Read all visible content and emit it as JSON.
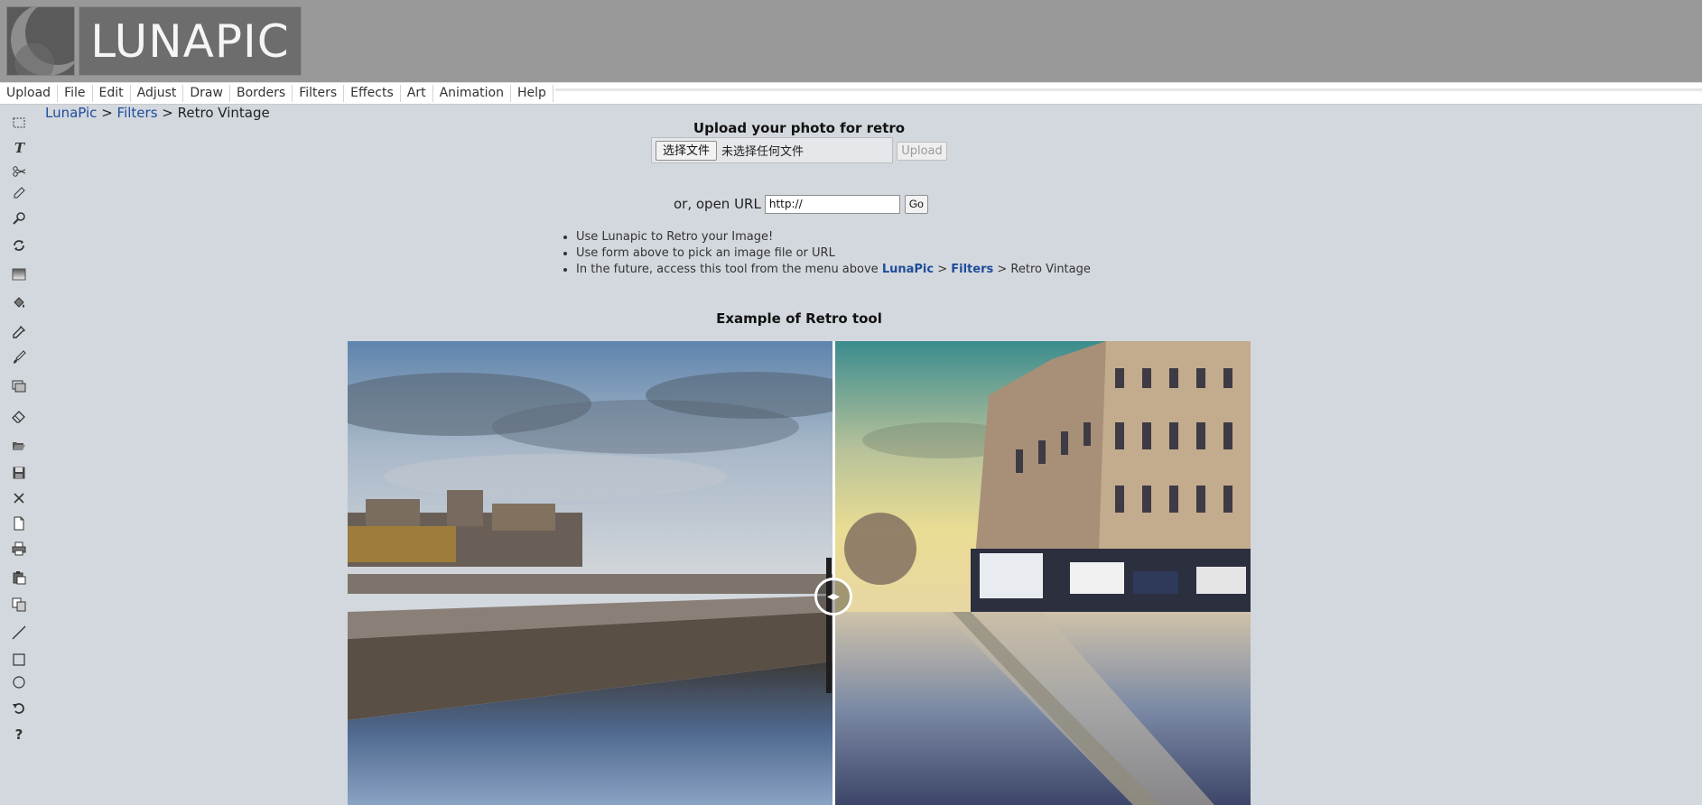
{
  "app": {
    "logo_text": "LUNAPIC"
  },
  "menu": {
    "items": [
      "Upload",
      "File",
      "Edit",
      "Adjust",
      "Draw",
      "Borders",
      "Filters",
      "Effects",
      "Art",
      "Animation",
      "Help"
    ]
  },
  "toolbar": {
    "tools": [
      "marquee-select-icon",
      "text-icon",
      "scissors-icon",
      "pencil-icon",
      "zoom-icon",
      "rotate-icon",
      "gradient-icon",
      "paint-bucket-icon",
      "color-picker-icon",
      "brush-icon",
      "image-stack-icon",
      "eraser-icon",
      "open-folder-icon",
      "save-icon",
      "close-icon",
      "new-document-icon",
      "print-icon",
      "paste-icon",
      "copy-icon",
      "line-icon",
      "rectangle-icon",
      "circle-icon",
      "undo-icon",
      "help-icon"
    ]
  },
  "breadcrumb": {
    "home": "LunaPic",
    "sep1": " > ",
    "section": "Filters",
    "sep2": " > ",
    "current": "Retro Vintage"
  },
  "upload": {
    "title": "Upload your photo for retro",
    "choose_file_label": "选择文件",
    "file_status": "未选择任何文件",
    "upload_button": "Upload",
    "url_label": "or, open URL",
    "url_value": "http://",
    "go_button": "Go"
  },
  "tips": {
    "tip1": "Use Lunapic to Retro your Image!",
    "tip2": "Use form above to pick an image file or URL",
    "tip3_prefix": "In the future, access this tool from the menu above ",
    "tip3_link1": "LunaPic",
    "tip3_sep1": " > ",
    "tip3_link2": "Filters",
    "tip3_sep2": " > ",
    "tip3_suffix": "Retro Vintage"
  },
  "example": {
    "title": "Example of Retro tool",
    "handle_glyph": "◂▸"
  },
  "colors": {
    "header_bg": "#999999",
    "page_bg": "#d3d8de",
    "link": "#1f4c9a"
  }
}
